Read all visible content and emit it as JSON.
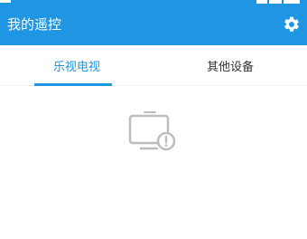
{
  "header": {
    "title": "我的遥控",
    "settings_icon": "gear-icon",
    "background": "#1e96e3"
  },
  "tabs": [
    {
      "label": "乐视电视",
      "active": true
    },
    {
      "label": "其他设备",
      "active": false
    }
  ],
  "colors": {
    "accent": "#1e96e3",
    "tab_text": "#333333",
    "placeholder_icon": "#bdbdbd"
  },
  "empty_state": {
    "icon": "tv-alert-icon"
  }
}
